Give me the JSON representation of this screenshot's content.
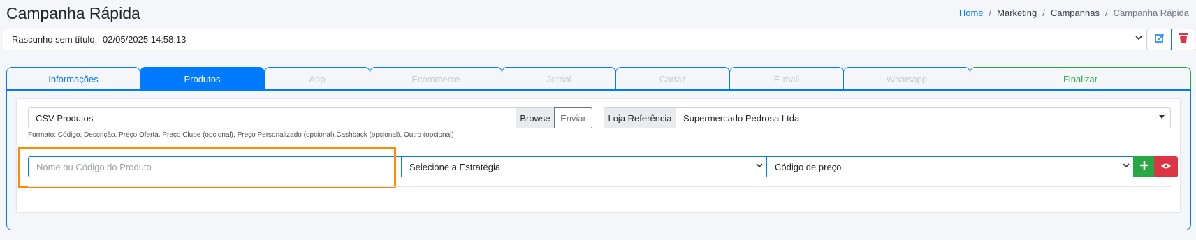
{
  "header": {
    "title": "Campanha Rápida"
  },
  "breadcrumb": [
    {
      "label": "Home"
    },
    {
      "label": "Marketing"
    },
    {
      "label": "Campanhas"
    },
    {
      "label": "Campanha Rápida"
    }
  ],
  "breadcrumb_separator": "/",
  "draft": {
    "selected": "Rascunho sem título - 02/05/2025 14:58:13",
    "edit_icon": "edit-icon",
    "delete_icon": "trash-icon"
  },
  "tabs": [
    {
      "label": "Informações",
      "state": "enabled"
    },
    {
      "label": "Produtos",
      "state": "active"
    },
    {
      "label": "App",
      "state": "disabled"
    },
    {
      "label": "Ecommerce",
      "state": "disabled"
    },
    {
      "label": "Jornal",
      "state": "disabled"
    },
    {
      "label": "Cartaz",
      "state": "disabled"
    },
    {
      "label": "E-mail",
      "state": "disabled"
    },
    {
      "label": "Whatsapp",
      "state": "disabled"
    },
    {
      "label": "Finalizar",
      "state": "enabled"
    }
  ],
  "csv": {
    "label": "CSV Produtos",
    "browse_label": "Browse",
    "send_label": "Enviar",
    "format_help": "Formato: Código, Descrição, Preço Oferta, Preço Clube (opcional), Preço Personalizado (opcional),Cashback (opcional), Outro (opcional)"
  },
  "store": {
    "label": "Loja Referência",
    "selected": "Supermercado Pedrosa Ltda"
  },
  "product": {
    "search_placeholder": "Nome ou Código do Produto",
    "strategy_selected": "Selecione a Estratégia",
    "price_code_selected": "Código de preço",
    "add_icon": "plus-icon",
    "view_icon": "eye-icon"
  },
  "colors": {
    "primary": "#007bff",
    "success": "#28a745",
    "danger": "#dc3545",
    "highlight": "#ff8c00"
  }
}
